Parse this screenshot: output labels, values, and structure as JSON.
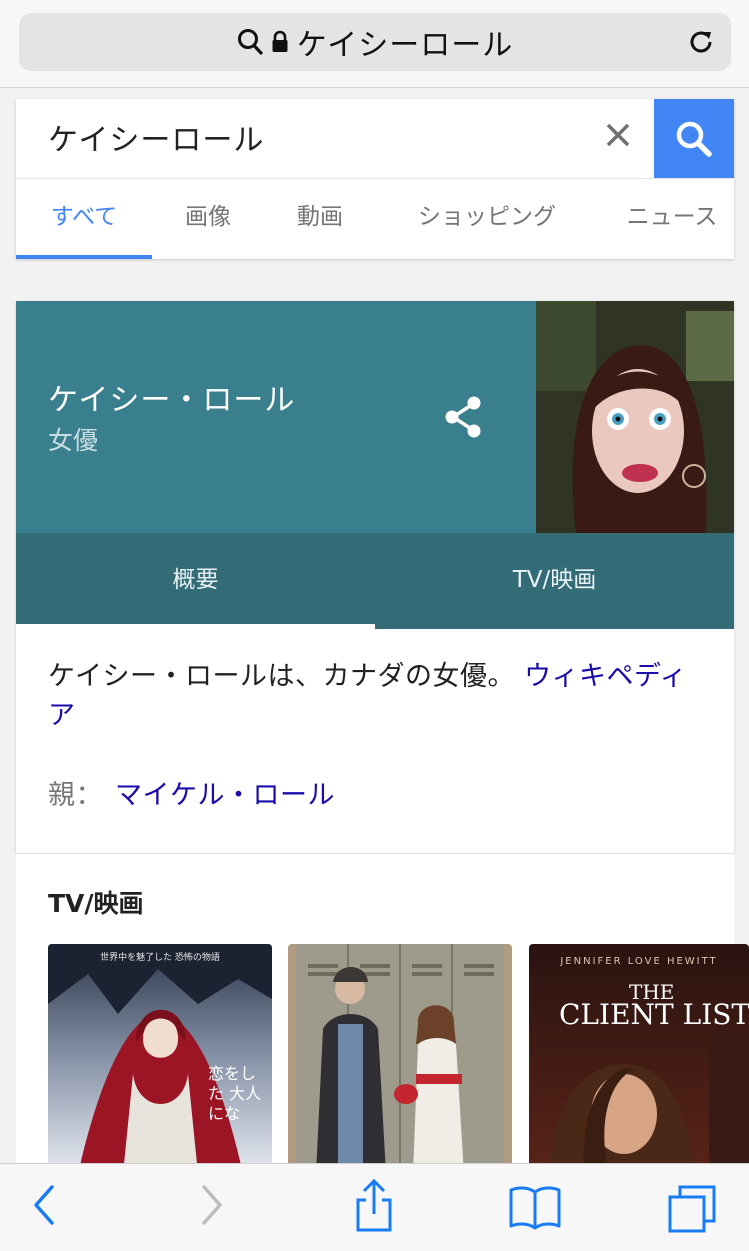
{
  "browser": {
    "url_text": "ケイシーロール",
    "icons": [
      "search-icon",
      "lock-icon",
      "reload-icon"
    ]
  },
  "search": {
    "query": "ケイシーロール",
    "tabs": [
      "すべて",
      "画像",
      "動画",
      "ショッピング",
      "ニュース"
    ],
    "active_tab": "すべて",
    "accent_color": "#4285f4"
  },
  "knowledge_panel": {
    "name": "ケイシー・ロール",
    "subtitle": "女優",
    "header_color": "#3a7f8d",
    "tabs": [
      "概要",
      "TV/映画"
    ],
    "active_tab": "概要",
    "description_text": "ケイシー・ロールは、カナダの女優。",
    "description_link": "ウィキペディア",
    "parent_label": "親：",
    "parent_value": "マイケル・ロール",
    "link_color": "#1a0dab"
  },
  "tv_section": {
    "title": "TV/映画",
    "poster_texts": {
      "p1_top": "世界中を魅了した 恐怖の物語",
      "p1_side": "恋をした 大人にな",
      "p3_top": "JENNIFER LOVE HEWITT",
      "p3_title_line1": "THE",
      "p3_title_line2": "CLIENT LIST"
    }
  },
  "toolbar": {
    "icons": [
      "back-icon",
      "forward-icon",
      "share-icon",
      "bookmarks-icon",
      "tabs-icon"
    ],
    "tint_color": "#1a7cf5"
  }
}
